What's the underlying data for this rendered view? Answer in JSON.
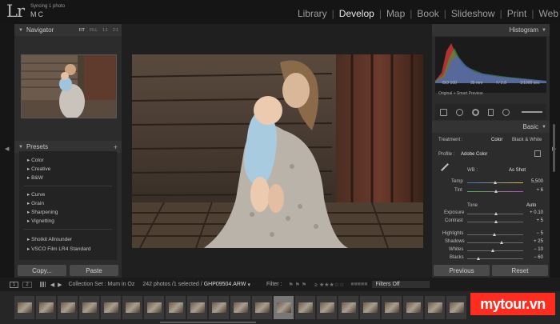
{
  "header": {
    "logo": "Lr",
    "sync_status": "Syncing 1 photo",
    "catalog_id": "MC",
    "modules": [
      "Library",
      "Develop",
      "Map",
      "Book",
      "Slideshow",
      "Print",
      "Web"
    ],
    "active_module": "Develop"
  },
  "left_panel": {
    "navigator": {
      "title": "Navigator",
      "zoom": [
        "FIT",
        "FILL",
        "1:1",
        "2:1"
      ]
    },
    "presets": {
      "title": "Presets",
      "items": [
        "Color",
        "Creative",
        "B&W",
        "Curve",
        "Grain",
        "Sharpening",
        "Vignetting",
        "Shotkit Allrounder",
        "VSCO Film LR4 Standard"
      ]
    },
    "copy_button": "Copy...",
    "paste_button": "Paste"
  },
  "right_panel": {
    "histogram_title": "Histogram",
    "histogram_info": {
      "iso": "ISO 100",
      "focal": "35 mm",
      "aperture": "f / 2.8",
      "shutter": "1/1000 sec"
    },
    "preview_state": "Original + Smart Preview",
    "basic_title": "Basic",
    "treatment_label": "Treatment :",
    "treatment_color": "Color",
    "treatment_bw": "Black & White",
    "profile_label": "Profile :",
    "profile_value": "Adobe Color",
    "wb_label": "WB :",
    "wb_value": "As Shot",
    "temp_label": "Temp",
    "temp_value": "5,500",
    "tint_label": "Tint",
    "tint_value": "+ 6",
    "tone_label": "Tone",
    "auto_label": "Auto",
    "exposure_label": "Exposure",
    "exposure_value": "+ 0.10",
    "contrast_label": "Contrast",
    "contrast_value": "+ 5",
    "highlights_label": "Highlights",
    "highlights_value": "− 5",
    "shadows_label": "Shadows",
    "shadows_value": "+ 25",
    "whites_label": "Whites",
    "whites_value": "− 10",
    "blacks_label": "Blacks",
    "blacks_value": "− 60",
    "previous_button": "Previous",
    "reset_button": "Reset"
  },
  "filmstrip_bar": {
    "page1": "1",
    "page2": "2",
    "collection": "Collection Set : Mum in Oz",
    "count": "242 photos /1 selected /",
    "filename": "GHP09504.ARW",
    "filter_label": "Filter :",
    "filters_off": "Filters Off"
  },
  "slider_levels": {
    "temp": 0.5,
    "tint": 0.52,
    "exposure": 0.51,
    "contrast": 0.52,
    "highlights": 0.48,
    "shadows": 0.62,
    "whites": 0.46,
    "blacks": 0.2
  },
  "colors": {
    "accent_red": "#ff2d20",
    "panel_bg": "#2c2c2c",
    "app_bg": "#1f1f1f"
  },
  "icons": [
    "triangle-down-icon",
    "triangle-left-icon",
    "triangle-right-icon",
    "plus-icon",
    "eyedropper-icon",
    "grid-icon",
    "star-icon",
    "flag-icon",
    "arrow-left-icon",
    "arrow-right-icon"
  ],
  "watermark": "mytour.vn"
}
